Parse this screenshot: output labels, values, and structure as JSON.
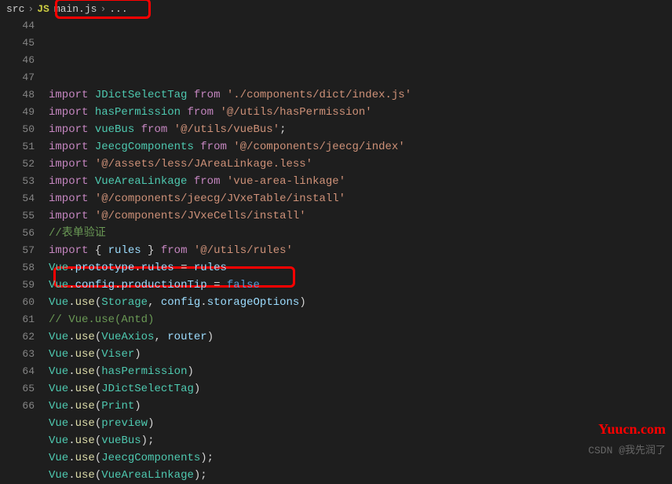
{
  "breadcrumb": {
    "root": "src",
    "file": "main.js",
    "fileIconText": "JS",
    "trail": "..."
  },
  "lineStart": 44,
  "lines": [
    {
      "n": 44,
      "tokens": [
        [
          "kw",
          "import"
        ],
        [
          "p",
          " "
        ],
        [
          "cls",
          "JDictSelectTag"
        ],
        [
          "p",
          " "
        ],
        [
          "kw",
          "from"
        ],
        [
          "p",
          " "
        ],
        [
          "str",
          "'./components/dict/index.js'"
        ]
      ]
    },
    {
      "n": 45,
      "tokens": [
        [
          "kw",
          "import"
        ],
        [
          "p",
          " "
        ],
        [
          "cls",
          "hasPermission"
        ],
        [
          "p",
          " "
        ],
        [
          "kw",
          "from"
        ],
        [
          "p",
          " "
        ],
        [
          "str",
          "'@/utils/hasPermission'"
        ]
      ]
    },
    {
      "n": 46,
      "tokens": [
        [
          "kw",
          "import"
        ],
        [
          "p",
          " "
        ],
        [
          "cls",
          "vueBus"
        ],
        [
          "p",
          " "
        ],
        [
          "kw",
          "from"
        ],
        [
          "p",
          " "
        ],
        [
          "str",
          "'@/utils/vueBus'"
        ],
        [
          "p",
          ";"
        ]
      ]
    },
    {
      "n": 47,
      "tokens": [
        [
          "kw",
          "import"
        ],
        [
          "p",
          " "
        ],
        [
          "cls",
          "JeecgComponents"
        ],
        [
          "p",
          " "
        ],
        [
          "kw",
          "from"
        ],
        [
          "p",
          " "
        ],
        [
          "str",
          "'@/components/jeecg/index'"
        ]
      ]
    },
    {
      "n": 48,
      "tokens": [
        [
          "kw",
          "import"
        ],
        [
          "p",
          " "
        ],
        [
          "str",
          "'@/assets/less/JAreaLinkage.less'"
        ]
      ]
    },
    {
      "n": 49,
      "tokens": [
        [
          "kw",
          "import"
        ],
        [
          "p",
          " "
        ],
        [
          "cls",
          "VueAreaLinkage"
        ],
        [
          "p",
          " "
        ],
        [
          "kw",
          "from"
        ],
        [
          "p",
          " "
        ],
        [
          "str",
          "'vue-area-linkage'"
        ]
      ]
    },
    {
      "n": 50,
      "tokens": [
        [
          "kw",
          "import"
        ],
        [
          "p",
          " "
        ],
        [
          "str",
          "'@/components/jeecg/JVxeTable/install'"
        ]
      ]
    },
    {
      "n": 51,
      "tokens": [
        [
          "kw",
          "import"
        ],
        [
          "p",
          " "
        ],
        [
          "str",
          "'@/components/JVxeCells/install'"
        ]
      ]
    },
    {
      "n": 52,
      "tokens": [
        [
          "cmt",
          "//表单验证"
        ]
      ]
    },
    {
      "n": 53,
      "tokens": [
        [
          "kw",
          "import"
        ],
        [
          "p",
          " { "
        ],
        [
          "id",
          "rules"
        ],
        [
          "p",
          " } "
        ],
        [
          "kw",
          "from"
        ],
        [
          "p",
          " "
        ],
        [
          "str",
          "'@/utils/rules'"
        ]
      ]
    },
    {
      "n": 54,
      "tokens": [
        [
          "cls",
          "Vue"
        ],
        [
          "p",
          "."
        ],
        [
          "id",
          "prototype"
        ],
        [
          "p",
          "."
        ],
        [
          "id",
          "rules"
        ],
        [
          "p",
          " = "
        ],
        [
          "id",
          "rules"
        ]
      ]
    },
    {
      "n": 55,
      "tokens": [
        [
          "cls",
          "Vue"
        ],
        [
          "p",
          "."
        ],
        [
          "id",
          "config"
        ],
        [
          "p",
          "."
        ],
        [
          "id",
          "productionTip"
        ],
        [
          "p",
          " = "
        ],
        [
          "const",
          "false"
        ]
      ]
    },
    {
      "n": 56,
      "tokens": [
        [
          "cls",
          "Vue"
        ],
        [
          "p",
          "."
        ],
        [
          "fn",
          "use"
        ],
        [
          "p",
          "("
        ],
        [
          "cls",
          "Storage"
        ],
        [
          "p",
          ", "
        ],
        [
          "id",
          "config"
        ],
        [
          "p",
          "."
        ],
        [
          "id",
          "storageOptions"
        ],
        [
          "p",
          ")"
        ]
      ]
    },
    {
      "n": 57,
      "tokens": [
        [
          "cmt",
          "// Vue.use(Antd)"
        ]
      ]
    },
    {
      "n": 58,
      "tokens": [
        [
          "cls",
          "Vue"
        ],
        [
          "p",
          "."
        ],
        [
          "fn",
          "use"
        ],
        [
          "p",
          "("
        ],
        [
          "cls",
          "VueAxios"
        ],
        [
          "p",
          ", "
        ],
        [
          "id",
          "router"
        ],
        [
          "p",
          ")"
        ]
      ]
    },
    {
      "n": 59,
      "tokens": [
        [
          "cls",
          "Vue"
        ],
        [
          "p",
          "."
        ],
        [
          "fn",
          "use"
        ],
        [
          "p",
          "("
        ],
        [
          "cls",
          "Viser"
        ],
        [
          "p",
          ")"
        ]
      ]
    },
    {
      "n": 60,
      "tokens": [
        [
          "cls",
          "Vue"
        ],
        [
          "p",
          "."
        ],
        [
          "fn",
          "use"
        ],
        [
          "p",
          "("
        ],
        [
          "cls",
          "hasPermission"
        ],
        [
          "p",
          ")"
        ]
      ]
    },
    {
      "n": 61,
      "tokens": [
        [
          "cls",
          "Vue"
        ],
        [
          "p",
          "."
        ],
        [
          "fn",
          "use"
        ],
        [
          "p",
          "("
        ],
        [
          "cls",
          "JDictSelectTag"
        ],
        [
          "p",
          ")"
        ]
      ]
    },
    {
      "n": 62,
      "tokens": [
        [
          "cls",
          "Vue"
        ],
        [
          "p",
          "."
        ],
        [
          "fn",
          "use"
        ],
        [
          "p",
          "("
        ],
        [
          "cls",
          "Print"
        ],
        [
          "p",
          ")"
        ]
      ]
    },
    {
      "n": 63,
      "tokens": [
        [
          "cls",
          "Vue"
        ],
        [
          "p",
          "."
        ],
        [
          "fn",
          "use"
        ],
        [
          "p",
          "("
        ],
        [
          "cls",
          "preview"
        ],
        [
          "p",
          ")"
        ]
      ]
    },
    {
      "n": 64,
      "tokens": [
        [
          "cls",
          "Vue"
        ],
        [
          "p",
          "."
        ],
        [
          "fn",
          "use"
        ],
        [
          "p",
          "("
        ],
        [
          "cls",
          "vueBus"
        ],
        [
          "p",
          ");"
        ]
      ]
    },
    {
      "n": 65,
      "tokens": [
        [
          "cls",
          "Vue"
        ],
        [
          "p",
          "."
        ],
        [
          "fn",
          "use"
        ],
        [
          "p",
          "("
        ],
        [
          "cls",
          "JeecgComponents"
        ],
        [
          "p",
          ");"
        ]
      ]
    },
    {
      "n": 66,
      "tokens": [
        [
          "cls",
          "Vue"
        ],
        [
          "p",
          "."
        ],
        [
          "fn",
          "use"
        ],
        [
          "p",
          "("
        ],
        [
          "cls",
          "VueAreaLinkage"
        ],
        [
          "p",
          ");"
        ]
      ]
    }
  ],
  "watermarks": {
    "site": "Yuucn.com",
    "csdn": "CSDN @我先润了"
  }
}
